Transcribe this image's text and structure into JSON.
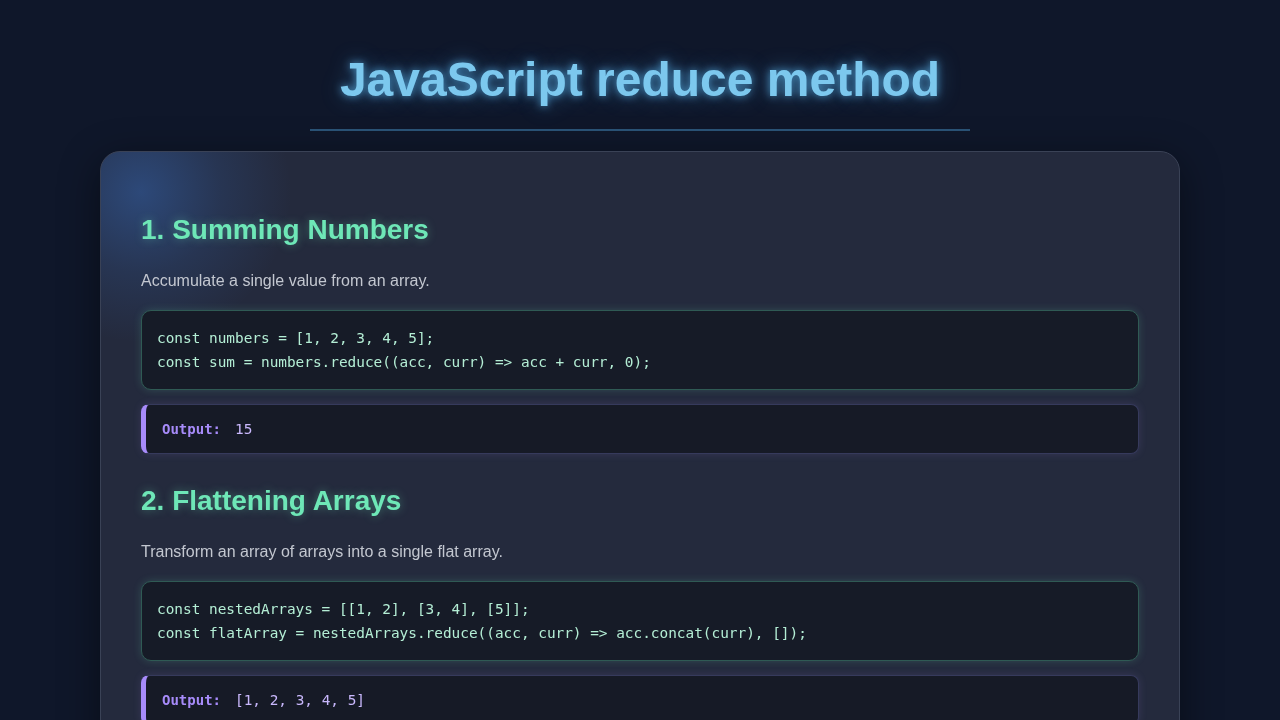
{
  "title": "JavaScript reduce method",
  "sections": [
    {
      "heading": "1. Summing Numbers",
      "description": "Accumulate a single value from an array.",
      "code": [
        "const numbers = [1, 2, 3, 4, 5];",
        "const sum = numbers.reduce((acc, curr) => acc + curr, 0);"
      ],
      "output": {
        "label": "Output:",
        "value": "15"
      }
    },
    {
      "heading": "2. Flattening Arrays",
      "description": "Transform an array of arrays into a single flat array.",
      "code": [
        "const nestedArrays = [[1, 2], [3, 4], [5]];",
        "const flatArray = nestedArrays.reduce((acc, curr) => acc.concat(curr), []);"
      ],
      "output": {
        "label": "Output:",
        "value": "[1, 2, 3, 4, 5]"
      }
    }
  ]
}
